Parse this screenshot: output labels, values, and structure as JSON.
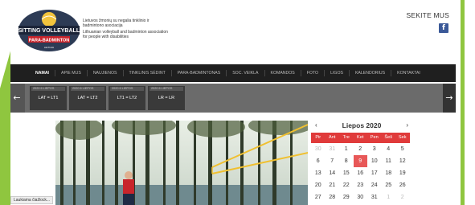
{
  "header": {
    "logo_text_top": "SITTING VOLLEYBALL",
    "logo_text_bottom": "PARA-BADMINTON",
    "logo_text_small": "LIETUVA",
    "tagline_lt": "Lietuvos žmonių su negalia tinklinio ir badmintono asociacija",
    "tagline_en": "Lithuanian volleyball and badminton association for people with disabilities",
    "follow_label": "SEKITE MUS",
    "facebook_icon": "f"
  },
  "nav": {
    "items": [
      {
        "label": "Namai",
        "active": true
      },
      {
        "label": "Apie mus"
      },
      {
        "label": "Naujienos"
      },
      {
        "label": "Tinklinis sėdint"
      },
      {
        "label": "Para-badmintonas"
      },
      {
        "label": "Soc. veikla"
      },
      {
        "label": "Komandos"
      },
      {
        "label": "Foto"
      },
      {
        "label": "Ligos"
      },
      {
        "label": "Kalendorius"
      },
      {
        "label": "Kontaktai"
      }
    ]
  },
  "results": [
    {
      "date": "2020 6 LIEPOS",
      "score": "LAT = LT1"
    },
    {
      "date": "2020 6 LIEPOS",
      "score": "LAT = LT2"
    },
    {
      "date": "2020 6 LIEPOS",
      "score": "LT1 = LT2"
    },
    {
      "date": "2020 6 LIEPOS",
      "score": "LR = LR"
    }
  ],
  "carousel": {
    "prev_icon": "←",
    "next_icon": "→"
  },
  "status_bar": "Laukiama čiažlock...",
  "calendar": {
    "title": "Liepos 2020",
    "prev": "‹",
    "next": "›",
    "weekdays": [
      "Pir",
      "Ant",
      "Tre",
      "Ket",
      "Pen",
      "Šeš",
      "Sek"
    ],
    "weeks": [
      [
        "30",
        "31",
        "1",
        "2",
        "3",
        "4",
        "5"
      ],
      [
        "6",
        "7",
        "8",
        "9",
        "10",
        "11",
        "12"
      ],
      [
        "13",
        "14",
        "15",
        "16",
        "17",
        "18",
        "19"
      ],
      [
        "20",
        "21",
        "22",
        "23",
        "24",
        "25",
        "26"
      ],
      [
        "27",
        "28",
        "29",
        "30",
        "31",
        "1",
        "2"
      ]
    ],
    "today": "9"
  }
}
